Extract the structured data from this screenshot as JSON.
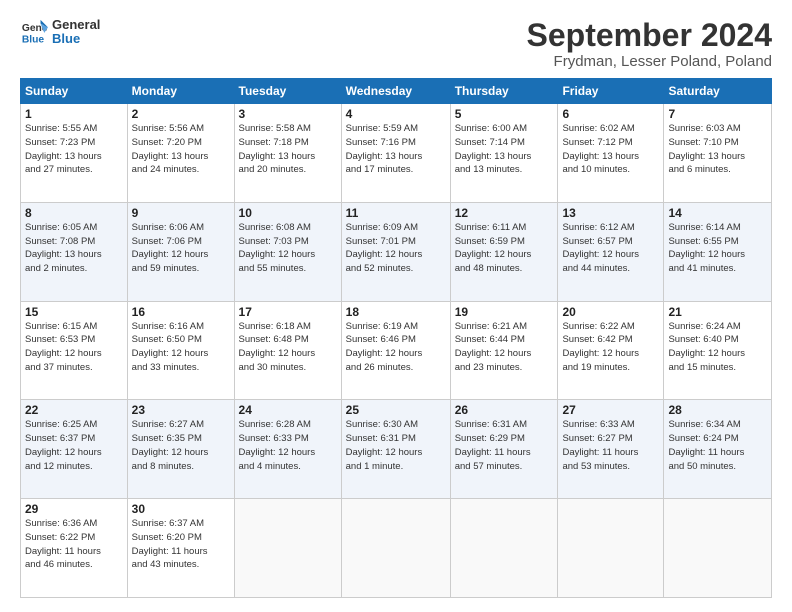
{
  "header": {
    "logo_line1": "General",
    "logo_line2": "Blue",
    "title": "September 2024",
    "subtitle": "Frydman, Lesser Poland, Poland"
  },
  "calendar": {
    "days_of_week": [
      "Sunday",
      "Monday",
      "Tuesday",
      "Wednesday",
      "Thursday",
      "Friday",
      "Saturday"
    ],
    "weeks": [
      [
        null,
        {
          "day": "2",
          "info": "Sunrise: 5:56 AM\nSunset: 7:20 PM\nDaylight: 13 hours\nand 24 minutes."
        },
        {
          "day": "3",
          "info": "Sunrise: 5:58 AM\nSunset: 7:18 PM\nDaylight: 13 hours\nand 20 minutes."
        },
        {
          "day": "4",
          "info": "Sunrise: 5:59 AM\nSunset: 7:16 PM\nDaylight: 13 hours\nand 17 minutes."
        },
        {
          "day": "5",
          "info": "Sunrise: 6:00 AM\nSunset: 7:14 PM\nDaylight: 13 hours\nand 13 minutes."
        },
        {
          "day": "6",
          "info": "Sunrise: 6:02 AM\nSunset: 7:12 PM\nDaylight: 13 hours\nand 10 minutes."
        },
        {
          "day": "7",
          "info": "Sunrise: 6:03 AM\nSunset: 7:10 PM\nDaylight: 13 hours\nand 6 minutes."
        }
      ],
      [
        {
          "day": "1",
          "info": "Sunrise: 5:55 AM\nSunset: 7:23 PM\nDaylight: 13 hours\nand 27 minutes."
        },
        null,
        null,
        null,
        null,
        null,
        null
      ],
      [
        {
          "day": "8",
          "info": "Sunrise: 6:05 AM\nSunset: 7:08 PM\nDaylight: 13 hours\nand 2 minutes."
        },
        {
          "day": "9",
          "info": "Sunrise: 6:06 AM\nSunset: 7:06 PM\nDaylight: 12 hours\nand 59 minutes."
        },
        {
          "day": "10",
          "info": "Sunrise: 6:08 AM\nSunset: 7:03 PM\nDaylight: 12 hours\nand 55 minutes."
        },
        {
          "day": "11",
          "info": "Sunrise: 6:09 AM\nSunset: 7:01 PM\nDaylight: 12 hours\nand 52 minutes."
        },
        {
          "day": "12",
          "info": "Sunrise: 6:11 AM\nSunset: 6:59 PM\nDaylight: 12 hours\nand 48 minutes."
        },
        {
          "day": "13",
          "info": "Sunrise: 6:12 AM\nSunset: 6:57 PM\nDaylight: 12 hours\nand 44 minutes."
        },
        {
          "day": "14",
          "info": "Sunrise: 6:14 AM\nSunset: 6:55 PM\nDaylight: 12 hours\nand 41 minutes."
        }
      ],
      [
        {
          "day": "15",
          "info": "Sunrise: 6:15 AM\nSunset: 6:53 PM\nDaylight: 12 hours\nand 37 minutes."
        },
        {
          "day": "16",
          "info": "Sunrise: 6:16 AM\nSunset: 6:50 PM\nDaylight: 12 hours\nand 33 minutes."
        },
        {
          "day": "17",
          "info": "Sunrise: 6:18 AM\nSunset: 6:48 PM\nDaylight: 12 hours\nand 30 minutes."
        },
        {
          "day": "18",
          "info": "Sunrise: 6:19 AM\nSunset: 6:46 PM\nDaylight: 12 hours\nand 26 minutes."
        },
        {
          "day": "19",
          "info": "Sunrise: 6:21 AM\nSunset: 6:44 PM\nDaylight: 12 hours\nand 23 minutes."
        },
        {
          "day": "20",
          "info": "Sunrise: 6:22 AM\nSunset: 6:42 PM\nDaylight: 12 hours\nand 19 minutes."
        },
        {
          "day": "21",
          "info": "Sunrise: 6:24 AM\nSunset: 6:40 PM\nDaylight: 12 hours\nand 15 minutes."
        }
      ],
      [
        {
          "day": "22",
          "info": "Sunrise: 6:25 AM\nSunset: 6:37 PM\nDaylight: 12 hours\nand 12 minutes."
        },
        {
          "day": "23",
          "info": "Sunrise: 6:27 AM\nSunset: 6:35 PM\nDaylight: 12 hours\nand 8 minutes."
        },
        {
          "day": "24",
          "info": "Sunrise: 6:28 AM\nSunset: 6:33 PM\nDaylight: 12 hours\nand 4 minutes."
        },
        {
          "day": "25",
          "info": "Sunrise: 6:30 AM\nSunset: 6:31 PM\nDaylight: 12 hours\nand 1 minute."
        },
        {
          "day": "26",
          "info": "Sunrise: 6:31 AM\nSunset: 6:29 PM\nDaylight: 11 hours\nand 57 minutes."
        },
        {
          "day": "27",
          "info": "Sunrise: 6:33 AM\nSunset: 6:27 PM\nDaylight: 11 hours\nand 53 minutes."
        },
        {
          "day": "28",
          "info": "Sunrise: 6:34 AM\nSunset: 6:24 PM\nDaylight: 11 hours\nand 50 minutes."
        }
      ],
      [
        {
          "day": "29",
          "info": "Sunrise: 6:36 AM\nSunset: 6:22 PM\nDaylight: 11 hours\nand 46 minutes."
        },
        {
          "day": "30",
          "info": "Sunrise: 6:37 AM\nSunset: 6:20 PM\nDaylight: 11 hours\nand 43 minutes."
        },
        null,
        null,
        null,
        null,
        null
      ]
    ]
  }
}
